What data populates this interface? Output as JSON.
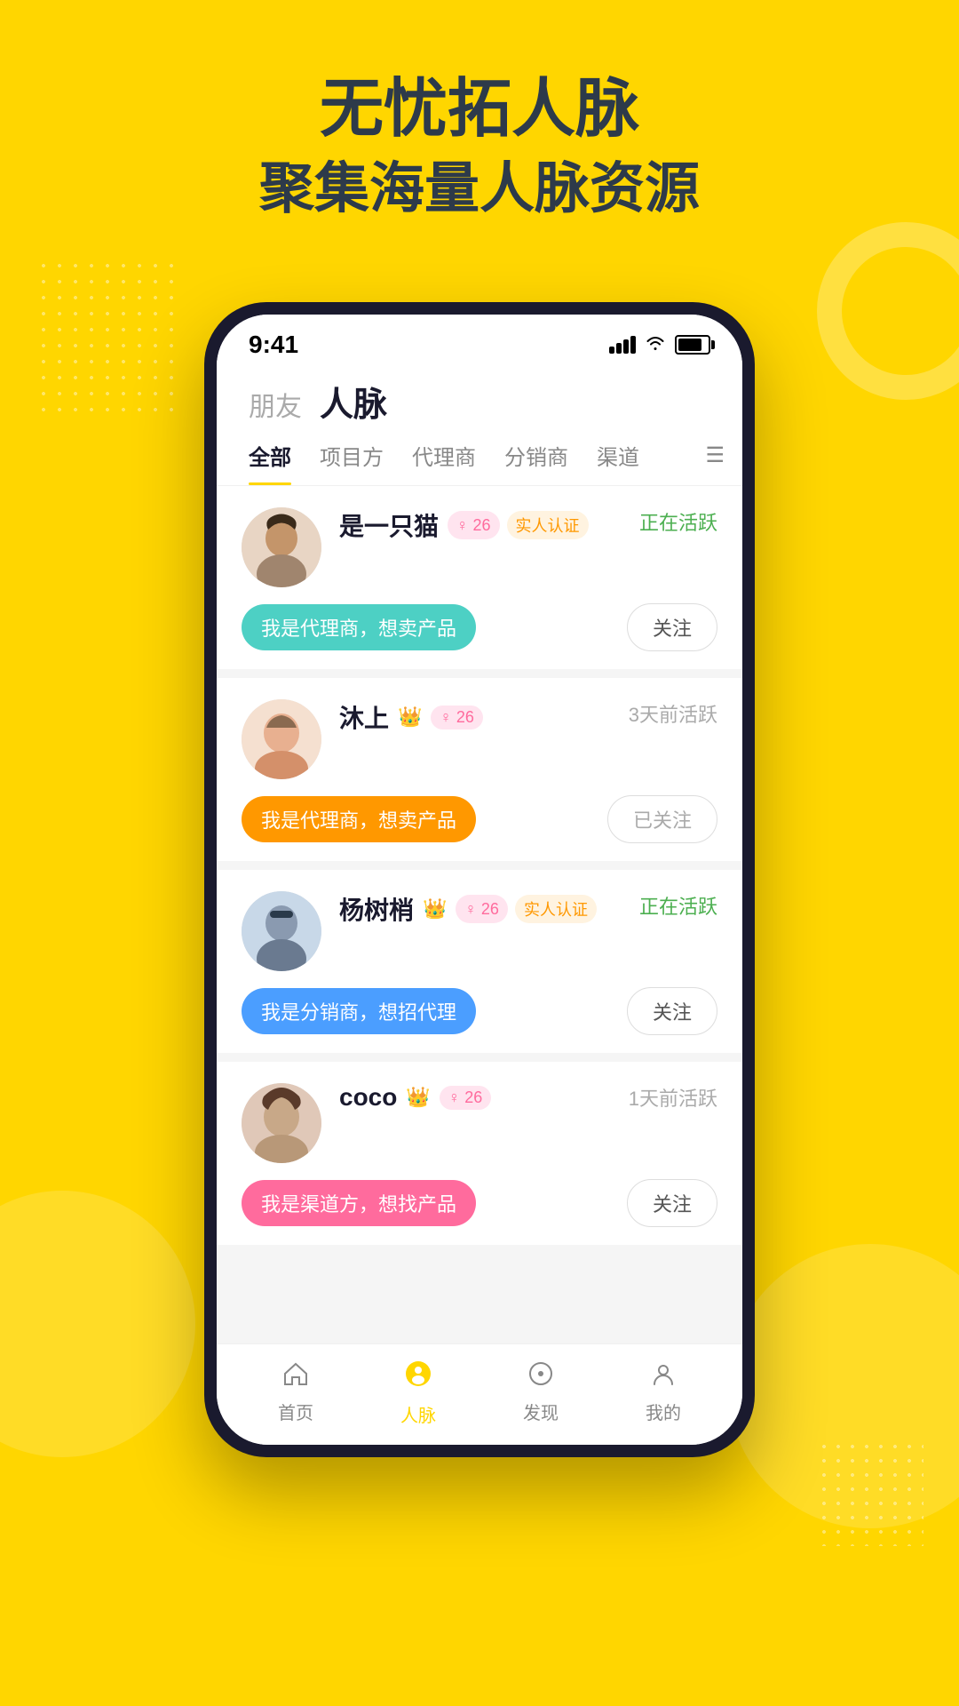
{
  "background_color": "#FFD600",
  "header": {
    "line1": "无忧拓人脉",
    "line2": "聚集海量人脉资源"
  },
  "status_bar": {
    "time": "9:41"
  },
  "page": {
    "inactive_tab": "朋友",
    "active_tab": "人脉"
  },
  "tabs": [
    {
      "label": "全部",
      "active": true
    },
    {
      "label": "项目方",
      "active": false
    },
    {
      "label": "代理商",
      "active": false
    },
    {
      "label": "分销商",
      "active": false
    },
    {
      "label": "渠道",
      "active": false
    }
  ],
  "contacts": [
    {
      "name": "是一只猫",
      "has_crown": false,
      "gender": "♀ 26",
      "verified": true,
      "verified_label": "实人认证",
      "status": "正在活跃",
      "status_active": true,
      "desc": "我是代理商，想卖产品",
      "desc_class": "desc-teal",
      "follow_label": "关注",
      "is_followed": false
    },
    {
      "name": "沐上",
      "has_crown": true,
      "gender": "♀ 26",
      "verified": false,
      "verified_label": "",
      "status": "3天前活跃",
      "status_active": false,
      "desc": "我是代理商，想卖产品",
      "desc_class": "desc-orange",
      "follow_label": "已关注",
      "is_followed": true
    },
    {
      "name": "杨树梢",
      "has_crown": true,
      "gender": "♀ 26",
      "verified": true,
      "verified_label": "实人认证",
      "status": "正在活跃",
      "status_active": true,
      "desc": "我是分销商，想招代理",
      "desc_class": "desc-blue",
      "follow_label": "关注",
      "is_followed": false
    },
    {
      "name": "coco",
      "has_crown": true,
      "gender": "♀ 26",
      "verified": false,
      "verified_label": "",
      "status": "1天前活跃",
      "status_active": false,
      "desc": "我是渠道方，想找产品",
      "desc_class": "desc-pink",
      "follow_label": "关注",
      "is_followed": false
    }
  ],
  "bottom_nav": [
    {
      "label": "首页",
      "active": false,
      "icon": "🔔"
    },
    {
      "label": "人脉",
      "active": true,
      "icon": "😊"
    },
    {
      "label": "发现",
      "active": false,
      "icon": "🔍"
    },
    {
      "label": "我的",
      "active": false,
      "icon": "👤"
    }
  ]
}
